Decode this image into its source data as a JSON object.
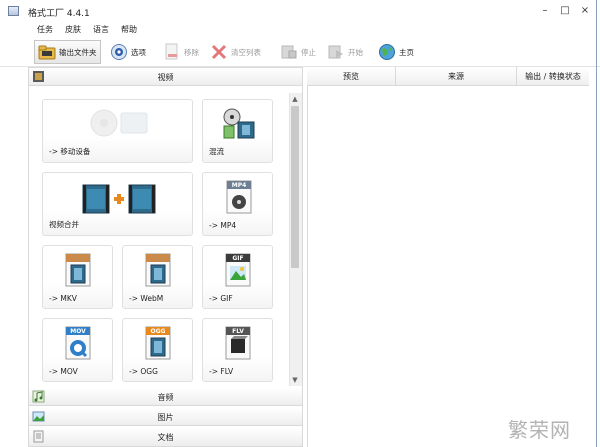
{
  "window": {
    "title": "格式工厂 4.4.1",
    "minimize": "–",
    "maximize": "□",
    "close": "×"
  },
  "menu": [
    "任务",
    "皮肤",
    "语言",
    "帮助"
  ],
  "toolbar": {
    "output_folder": "输出文件夹",
    "options": "选项",
    "remove": "移除",
    "clear_list": "清空列表",
    "stop": "停止",
    "start": "开始",
    "home": "主页"
  },
  "categories": {
    "video": "视频",
    "audio": "音频",
    "image": "图片",
    "document": "文档"
  },
  "tiles": {
    "mobile": "-> 移动设备",
    "mix": "混流",
    "merge": "视频合并",
    "mp4": "-> MP4",
    "mkv": "-> MKV",
    "webm": "-> WebM",
    "gif": "-> GIF",
    "mov": "-> MOV",
    "ogg": "-> OGG",
    "flv": "-> FLV"
  },
  "icon_badges": {
    "mp4": "MP4",
    "gif": "GIF",
    "mov": "MOV",
    "ogg": "OGG",
    "flv": "FLV"
  },
  "task_table": {
    "columns": [
      "预览",
      "来源",
      "输出 / 转换状态"
    ]
  },
  "scroll": {
    "up": "▲",
    "down": "▼"
  },
  "watermark": "繁荣网",
  "colors": {
    "accent_blue": "#2d6a8c",
    "orange": "#e8891f",
    "green": "#3aa33a"
  }
}
